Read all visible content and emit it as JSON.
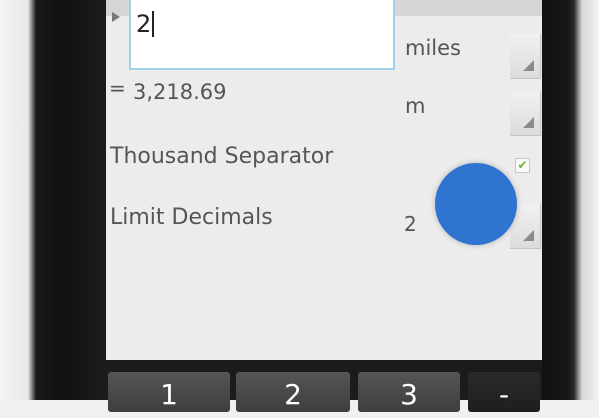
{
  "converter": {
    "input_value": "2",
    "from_unit": "miles",
    "result_prefix": "=",
    "result_value": "3,218.69",
    "to_unit": "m"
  },
  "settings": {
    "thousand_separator_label": "Thousand Separator",
    "thousand_separator_checked": true,
    "limit_decimals_label": "Limit Decimals",
    "limit_decimals_value": "2"
  },
  "keypad": {
    "keys": [
      "1",
      "2",
      "3",
      "-"
    ]
  },
  "colors": {
    "input_border": "#9fd3e7",
    "touch_indicator": "#2f74d0",
    "checkbox_check": "#6fb33a"
  }
}
